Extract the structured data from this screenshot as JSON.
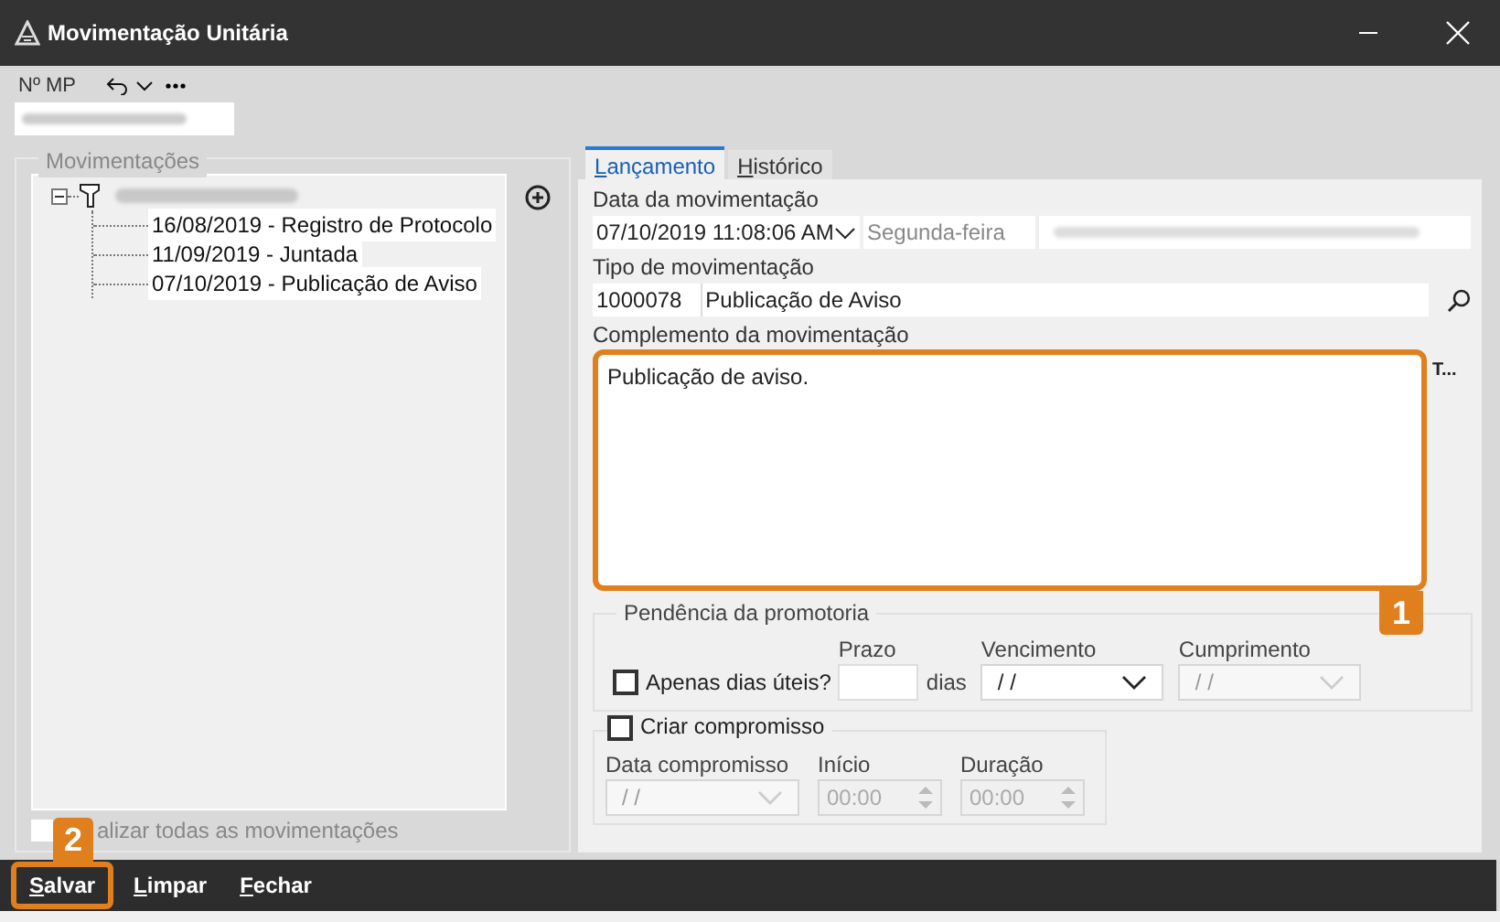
{
  "window": {
    "title": "Movimentação Unitária"
  },
  "mp": {
    "label": "Nº MP"
  },
  "movements": {
    "title": "Movimentações",
    "tree": [
      {
        "expanded": true,
        "children": [
          {
            "label": "16/08/2019 - Registro de Protocolo"
          },
          {
            "label": "11/09/2019 - Juntada"
          },
          {
            "label": "07/10/2019 - Publicação de Aviso"
          }
        ]
      }
    ]
  },
  "show_all": {
    "label": "alizar todas as movimentações",
    "checked": false
  },
  "tabs": [
    {
      "label": "Lançamento",
      "selected": true
    },
    {
      "label": "Histórico",
      "selected": false
    }
  ],
  "date_field": {
    "label": "Data da movimentação",
    "value": "07/10/2019 11:08:06 AM",
    "weekday": "Segunda-feira"
  },
  "type_field": {
    "label": "Tipo de movimentação",
    "code": "1000078",
    "name": "Publicação de Aviso"
  },
  "complement": {
    "label": "Complemento da movimentação",
    "value": "Publicação de aviso.",
    "side_text": "T...",
    "highlighted": true,
    "callout": "1"
  },
  "pending": {
    "title": "Pendência da promotoria",
    "business_days": {
      "label": "Apenas dias úteis?",
      "checked": false
    },
    "term": {
      "label": "Prazo",
      "unit": "dias"
    },
    "due": {
      "label": "Vencimento",
      "value": "/ /",
      "disabled": false
    },
    "fulfillment": {
      "label": "Cumprimento",
      "value": "/ /",
      "disabled": true
    }
  },
  "appointment": {
    "label": "Criar compromisso",
    "checked": false,
    "date": {
      "label": "Data compromisso",
      "value": "/ /",
      "disabled": true
    },
    "start": {
      "label": "Início",
      "value": "00:00",
      "disabled": true
    },
    "duration": {
      "label": "Duração",
      "value": "00:00",
      "disabled": true
    }
  },
  "buttons": [
    {
      "label": "Salvar",
      "highlighted": true,
      "callout": "2"
    },
    {
      "label": "Limpar",
      "highlighted": false
    },
    {
      "label": "Fechar",
      "highlighted": false
    }
  ]
}
